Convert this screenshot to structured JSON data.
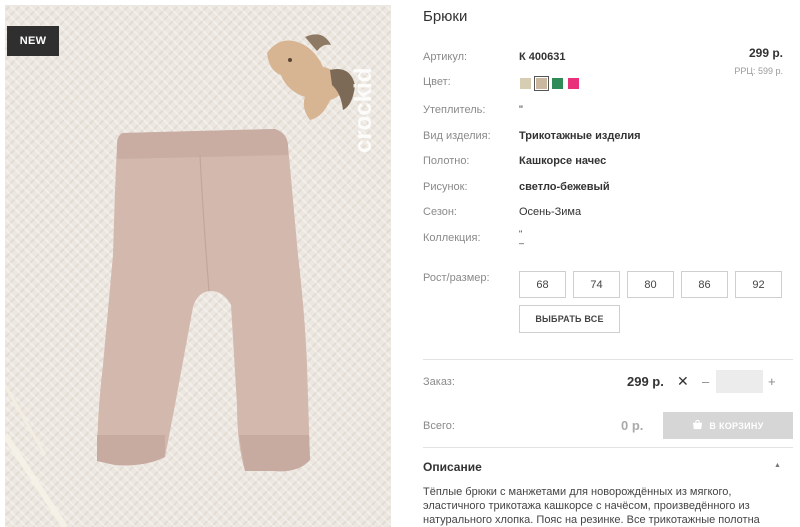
{
  "product": {
    "badge": "NEW",
    "brand": "crockid",
    "title": "Брюки",
    "price": "299 р.",
    "rrp": "РРЦ: 599 р."
  },
  "attributes": {
    "article_label": "Артикул:",
    "article_value": "К 400631",
    "color_label": "Цвет:",
    "insulation_label": "Утеплитель:",
    "insulation_value": "\"",
    "type_label": "Вид изделия:",
    "type_value": "Трикотажные изделия",
    "fabric_label": "Полотно:",
    "fabric_value": "Кашкорсе начес",
    "pattern_label": "Рисунок:",
    "pattern_value": "светло-бежевый",
    "season_label": "Сезон:",
    "season_value": "Осень-Зима",
    "collection_label": "Коллекция:",
    "collection_value_line1": "\"",
    "collection_value_line2": "–"
  },
  "colors": [
    {
      "name": "sand",
      "hex": "#d6cdb3",
      "selected": false
    },
    {
      "name": "beige",
      "hex": "#c9b79f",
      "selected": true
    },
    {
      "name": "green",
      "hex": "#2e8b57",
      "selected": false
    },
    {
      "name": "pink",
      "hex": "#e8317a",
      "selected": false
    }
  ],
  "sizes": {
    "label": "Рост/размер:",
    "options": [
      "68",
      "74",
      "80",
      "86",
      "92"
    ],
    "select_all": "ВЫБРАТЬ ВСЕ"
  },
  "order": {
    "label": "Заказ:",
    "price": "299 р.",
    "times": "✕",
    "minus": "–",
    "plus": "+",
    "quantity": ""
  },
  "total": {
    "label": "Всего:",
    "value": "0 р.",
    "cart_button": "В КОРЗИНУ"
  },
  "description": {
    "title": "Описание",
    "text": "Тёплые брюки с манжетами для новорождённых из мягкого, эластичного трикотажа кашкорсе с начёсом, произведённого из натурального хлопка. Пояс на резинке. Все трикотажные полотна"
  },
  "icons": {
    "collapse": "▲"
  }
}
